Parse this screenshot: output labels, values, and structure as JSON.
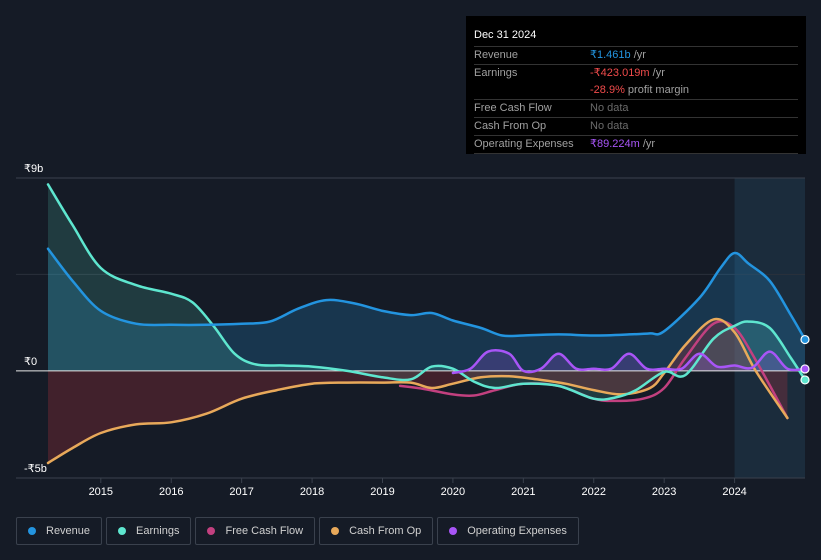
{
  "tooltip": {
    "date": "Dec 31 2024",
    "rows": [
      {
        "label": "Revenue",
        "value": "₹1.461b",
        "unit": " /yr",
        "color": "#2394df"
      },
      {
        "label": "Earnings",
        "value": "-₹423.019m",
        "unit": " /yr",
        "color": "#f04b4b"
      },
      {
        "label": "",
        "value": "-28.9%",
        "unit": " profit margin",
        "color": "#f04b4b"
      },
      {
        "label": "Free Cash Flow",
        "value": "No data",
        "unit": "",
        "color": "#6b6b6b"
      },
      {
        "label": "Cash From Op",
        "value": "No data",
        "unit": "",
        "color": "#6b6b6b"
      },
      {
        "label": "Operating Expenses",
        "value": "₹89.224m",
        "unit": " /yr",
        "color": "#a855f7"
      }
    ]
  },
  "legend": [
    {
      "label": "Revenue",
      "color": "#2394df"
    },
    {
      "label": "Earnings",
      "color": "#5ee6cf"
    },
    {
      "label": "Free Cash Flow",
      "color": "#c2407f"
    },
    {
      "label": "Cash From Op",
      "color": "#e8a95a"
    },
    {
      "label": "Operating Expenses",
      "color": "#a855f7"
    }
  ],
  "chart_data": {
    "type": "line",
    "title": "",
    "xlabel": "",
    "ylabel": "",
    "currency": "₹",
    "y_ticks": [
      {
        "value": 9,
        "label": "₹9b"
      },
      {
        "value": 0,
        "label": "₹0"
      },
      {
        "value": -5,
        "label": "-₹5b"
      }
    ],
    "ylim": [
      -5,
      9
    ],
    "xlim": [
      2014.25,
      2025.0
    ],
    "x_ticks": [
      "2015",
      "2016",
      "2017",
      "2018",
      "2019",
      "2020",
      "2021",
      "2022",
      "2023",
      "2024"
    ],
    "highlight_from": 2024.0,
    "grid": true,
    "legend_position": "bottom",
    "series": [
      {
        "name": "Revenue",
        "color": "#2394df",
        "fill": true,
        "x": [
          2014.25,
          2014.6,
          2015.0,
          2015.5,
          2016.0,
          2016.5,
          2017.0,
          2017.4,
          2017.8,
          2018.2,
          2018.6,
          2019.0,
          2019.4,
          2019.7,
          2020.0,
          2020.4,
          2020.7,
          2021.0,
          2021.5,
          2022.0,
          2022.5,
          2022.8,
          2023.0,
          2023.5,
          2023.8,
          2024.0,
          2024.2,
          2024.5,
          2024.8,
          2025.0
        ],
        "y": [
          5.7,
          4.2,
          2.8,
          2.2,
          2.15,
          2.15,
          2.2,
          2.3,
          2.9,
          3.3,
          3.15,
          2.8,
          2.6,
          2.7,
          2.35,
          2.0,
          1.65,
          1.65,
          1.7,
          1.65,
          1.7,
          1.75,
          1.85,
          3.4,
          4.8,
          5.5,
          5.0,
          4.2,
          2.6,
          1.461
        ]
      },
      {
        "name": "Earnings",
        "color": "#5ee6cf",
        "fill": true,
        "x": [
          2014.25,
          2014.6,
          2015.0,
          2015.5,
          2016.0,
          2016.3,
          2016.6,
          2016.9,
          2017.2,
          2017.6,
          2018.0,
          2018.5,
          2019.0,
          2019.4,
          2019.7,
          2020.0,
          2020.3,
          2020.6,
          2021.0,
          2021.5,
          2022.0,
          2022.3,
          2022.6,
          2023.0,
          2023.3,
          2023.7,
          2024.0,
          2024.2,
          2024.5,
          2024.8,
          2025.0
        ],
        "y": [
          8.7,
          6.8,
          4.8,
          4.0,
          3.6,
          3.2,
          2.1,
          0.8,
          0.3,
          0.25,
          0.2,
          0.0,
          -0.3,
          -0.4,
          0.2,
          0.1,
          -0.5,
          -0.8,
          -0.6,
          -0.7,
          -1.3,
          -1.25,
          -0.9,
          -0.05,
          -0.2,
          1.5,
          2.1,
          2.3,
          2.0,
          0.6,
          -0.423
        ]
      },
      {
        "name": "Free Cash Flow",
        "color": "#c2407f",
        "fill": false,
        "x": [
          2019.25,
          2019.6,
          2020.0,
          2020.3,
          2020.6,
          2021.0,
          2021.5,
          2022.0,
          2022.3,
          2022.7,
          2023.0,
          2023.3,
          2023.7,
          2024.0,
          2024.3,
          2024.75
        ],
        "y": [
          -0.7,
          -0.85,
          -1.1,
          -1.15,
          -0.9,
          -0.6,
          -0.7,
          -1.3,
          -1.4,
          -1.3,
          -0.8,
          0.6,
          2.2,
          2.0,
          0.5,
          -2.2
        ]
      },
      {
        "name": "Cash From Op",
        "color": "#e8a95a",
        "fill": true,
        "x": [
          2014.25,
          2014.6,
          2015.0,
          2015.5,
          2016.0,
          2016.5,
          2017.0,
          2017.5,
          2018.0,
          2018.5,
          2019.0,
          2019.4,
          2019.7,
          2020.0,
          2020.4,
          2020.8,
          2021.2,
          2021.6,
          2022.0,
          2022.4,
          2022.8,
          2023.0,
          2023.3,
          2023.7,
          2024.0,
          2024.3,
          2024.75
        ],
        "y": [
          -4.3,
          -3.6,
          -2.9,
          -2.5,
          -2.4,
          -2.0,
          -1.3,
          -0.9,
          -0.6,
          -0.55,
          -0.55,
          -0.55,
          -0.8,
          -0.6,
          -0.3,
          -0.25,
          -0.4,
          -0.6,
          -0.9,
          -1.1,
          -0.8,
          -0.1,
          1.2,
          2.4,
          1.8,
          0.0,
          -2.2
        ]
      },
      {
        "name": "Operating Expenses",
        "color": "#a855f7",
        "fill": true,
        "x": [
          2020.0,
          2020.25,
          2020.5,
          2020.8,
          2021.0,
          2021.25,
          2021.5,
          2021.75,
          2022.0,
          2022.25,
          2022.5,
          2022.75,
          2023.0,
          2023.25,
          2023.5,
          2023.75,
          2024.0,
          2024.25,
          2024.5,
          2024.75,
          2025.0
        ],
        "y": [
          -0.1,
          0.1,
          0.9,
          0.8,
          0.0,
          0.1,
          0.8,
          0.1,
          0.1,
          0.1,
          0.8,
          0.1,
          0.1,
          0.1,
          0.8,
          0.2,
          0.25,
          0.15,
          0.9,
          0.1,
          0.089
        ]
      }
    ]
  }
}
